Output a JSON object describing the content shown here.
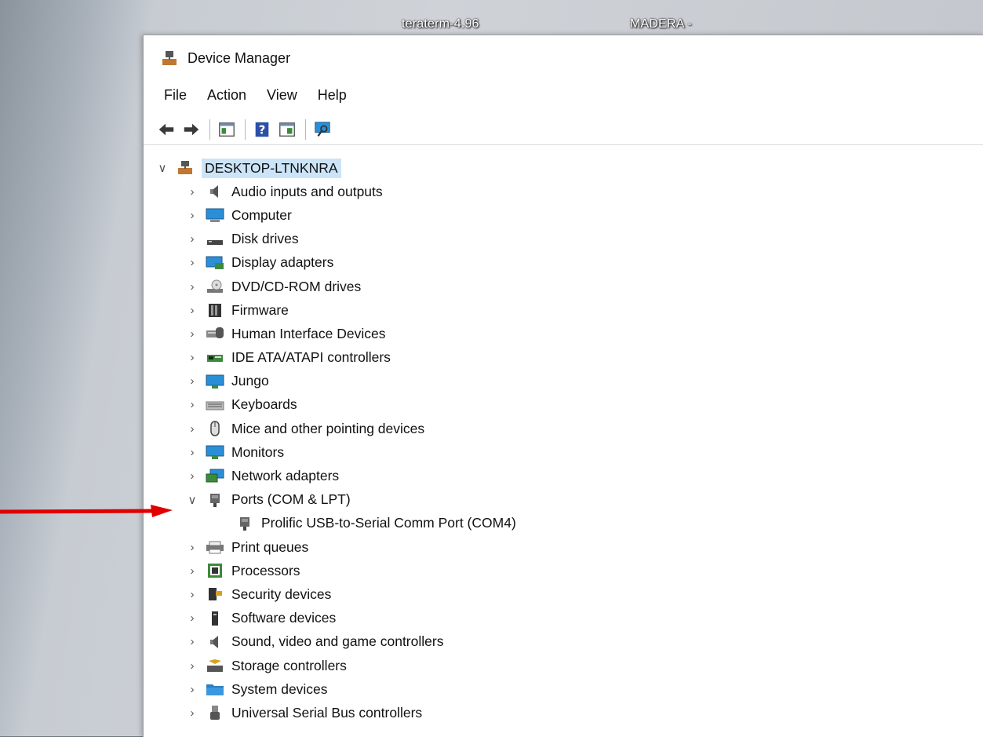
{
  "desktop": {
    "labels": [
      "teraterm-4.96",
      "MADERA -"
    ]
  },
  "window": {
    "title": "Device Manager",
    "menu": [
      "File",
      "Action",
      "View",
      "Help"
    ]
  },
  "tree": {
    "root": "DESKTOP-LTNKNRA",
    "categories": [
      {
        "label": "Audio inputs and outputs",
        "icon": "speaker-icon",
        "expanded": false
      },
      {
        "label": "Computer",
        "icon": "computer-icon",
        "expanded": false
      },
      {
        "label": "Disk drives",
        "icon": "disk-drive-icon",
        "expanded": false
      },
      {
        "label": "Display adapters",
        "icon": "display-adapter-icon",
        "expanded": false
      },
      {
        "label": "DVD/CD-ROM drives",
        "icon": "dvd-drive-icon",
        "expanded": false
      },
      {
        "label": "Firmware",
        "icon": "firmware-icon",
        "expanded": false
      },
      {
        "label": "Human Interface Devices",
        "icon": "hid-icon",
        "expanded": false
      },
      {
        "label": "IDE ATA/ATAPI controllers",
        "icon": "ide-controller-icon",
        "expanded": false
      },
      {
        "label": "Jungo",
        "icon": "monitor-icon",
        "expanded": false
      },
      {
        "label": "Keyboards",
        "icon": "keyboard-icon",
        "expanded": false
      },
      {
        "label": "Mice and other pointing devices",
        "icon": "mouse-icon",
        "expanded": false
      },
      {
        "label": "Monitors",
        "icon": "monitor-icon",
        "expanded": false
      },
      {
        "label": "Network adapters",
        "icon": "network-icon",
        "expanded": false
      },
      {
        "label": "Ports (COM & LPT)",
        "icon": "port-icon",
        "expanded": true,
        "children": [
          "Prolific USB-to-Serial Comm Port (COM4)"
        ]
      },
      {
        "label": "Print queues",
        "icon": "printer-icon",
        "expanded": false
      },
      {
        "label": "Processors",
        "icon": "processor-icon",
        "expanded": false
      },
      {
        "label": "Security devices",
        "icon": "security-icon",
        "expanded": false
      },
      {
        "label": "Software devices",
        "icon": "software-icon",
        "expanded": false
      },
      {
        "label": "Sound, video and game controllers",
        "icon": "speaker-icon",
        "expanded": false
      },
      {
        "label": "Storage controllers",
        "icon": "storage-icon",
        "expanded": false
      },
      {
        "label": "System devices",
        "icon": "folder-icon",
        "expanded": false
      },
      {
        "label": "Universal Serial Bus controllers",
        "icon": "usb-icon",
        "expanded": false
      }
    ]
  },
  "colors": {
    "selection": "#cce4f7",
    "arrow": "#e00000",
    "monitor_blue": "#2b8fd8"
  }
}
